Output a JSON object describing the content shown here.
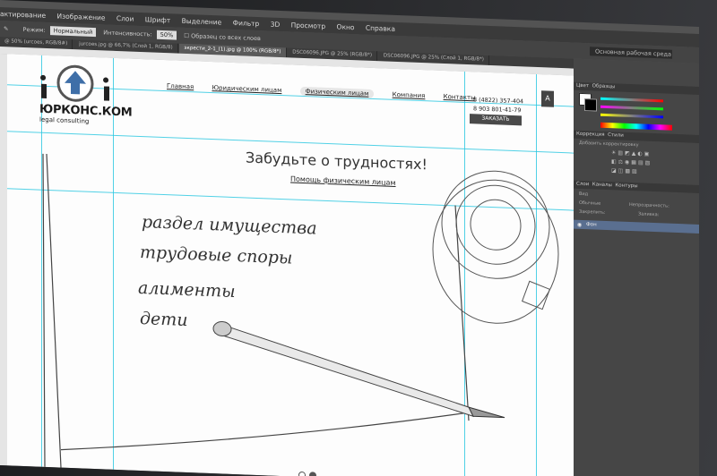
{
  "ps": {
    "menu": [
      "актирование",
      "Изображение",
      "Слои",
      "Шрифт",
      "Выделение",
      "Фильтр",
      "3D",
      "Просмотр",
      "Окно",
      "Справка"
    ],
    "options": {
      "mode_label": "Режим:",
      "mode_value": "Нормальный",
      "intensity_label": "Интенсивность:",
      "intensity_value": "50%",
      "all_layers_label": "Образец со всех слоев",
      "workspace": "Основная рабочая среда"
    },
    "tabs": [
      {
        "label": "@ 50% (urcoes, RGB/8#)"
      },
      {
        "label": "jurcoes.jpg @ 66,7% (Слой 1, RGB/8)"
      },
      {
        "label": "экрести_2-1_(1).jpg @ 100% (RGB/8*)"
      },
      {
        "label": "DSC06096.JPG @ 25% (RGB/8*)"
      },
      {
        "label": "DSC06096.JPG @ 25% (Слой 1, RGB/8*)"
      }
    ],
    "panels": {
      "color_tab": "Цвет",
      "swatches_tab": "Образцы",
      "correction_tab": "Коррекция",
      "styles_tab": "Стили",
      "add_adjustment": "Добавить корректировку",
      "layers_tab": "Слои",
      "channels_tab": "Каналы",
      "paths_tab": "Контуры",
      "kind_label": "Вид",
      "blend_mode": "Обычные",
      "opacity_label": "Непрозрачность:",
      "lock_label": "Закрепить:",
      "fill_label": "Заливка:",
      "layer_name": "Фон"
    }
  },
  "site": {
    "logo_text": "ЮРКОНС.КОМ",
    "logo_sub": "legal consulting",
    "nav": [
      {
        "label": "Главная",
        "active": false
      },
      {
        "label": "Юридическим лицам",
        "active": false
      },
      {
        "label": "Физическим лицам",
        "active": true
      },
      {
        "label": "Компания",
        "active": false
      },
      {
        "label": "Контакты",
        "active": false
      }
    ],
    "phone1": "8 (4822) 357-404",
    "phone2": "8 903 801-41-79",
    "call_button": "ЗАКАЗАТЬ ЗВОНОК",
    "headline": "Забудьте о трудностях!",
    "sublink": "Помощь физическим лицам",
    "sketch_lines": [
      "раздел имущества",
      "трудовые споры",
      "алименты",
      "дети"
    ]
  },
  "colors": {
    "guide": "#26c6e0",
    "ps_dark": "#3a3a3a",
    "layer_highlight": "#5a6f90"
  }
}
